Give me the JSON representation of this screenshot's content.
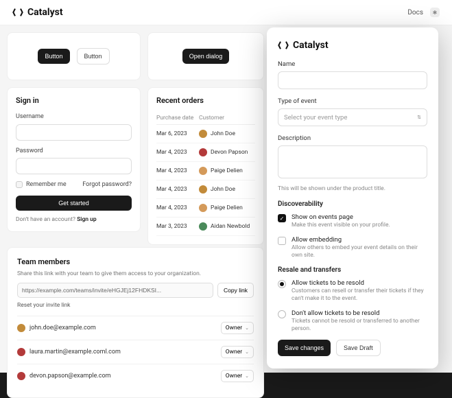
{
  "app": {
    "brand": "Catalyst",
    "docs": "Docs",
    "theme_icon": "✱"
  },
  "buttons_card": {
    "primary": "Button",
    "secondary": "Button"
  },
  "dialog_card": {
    "open": "Open dialog"
  },
  "signin": {
    "title": "Sign in",
    "username_label": "Username",
    "password_label": "Password",
    "remember": "Remember me",
    "forgot": "Forgot password?",
    "submit": "Get started",
    "hint_prefix": "Don't have an account? ",
    "hint_action": "Sign up"
  },
  "orders": {
    "title": "Recent orders",
    "col_date": "Purchase date",
    "col_customer": "Customer",
    "rows": [
      {
        "date": "Mar 6, 2023",
        "customer": "John Doe",
        "color": "#c28b3a"
      },
      {
        "date": "Mar 4, 2023",
        "customer": "Devon Papson",
        "color": "#b33a3a"
      },
      {
        "date": "Mar 4, 2023",
        "customer": "Paige Delien",
        "color": "#d49a5a"
      },
      {
        "date": "Mar 4, 2023",
        "customer": "John Doe",
        "color": "#c28b3a"
      },
      {
        "date": "Mar 4, 2023",
        "customer": "Paige Delien",
        "color": "#d49a5a"
      },
      {
        "date": "Mar 3, 2023",
        "customer": "Aidan Newbold",
        "color": "#4a8a5a"
      }
    ]
  },
  "team": {
    "title": "Team members",
    "subtitle": "Share this link with your team to give them access to your organization.",
    "invite_url": "https://example.com/teams/invite/eHGJEj12FHDKSI...",
    "copy": "Copy link",
    "reset": "Reset your invite link",
    "role_label": "Owner",
    "members": [
      {
        "email": "john.doe@example.com",
        "color": "#c28b3a"
      },
      {
        "email": "laura.martin@example.coml.com",
        "color": "#b33a3a"
      },
      {
        "email": "devon.papson@example.com",
        "color": "#b33a3a"
      }
    ]
  },
  "drawer": {
    "brand": "Catalyst",
    "name_label": "Name",
    "type_label": "Type of event",
    "type_placeholder": "Select your event type",
    "desc_label": "Description",
    "desc_hint": "This will be shown under the product title.",
    "disc_title": "Discoverability",
    "disc_opt1_title": "Show on events page",
    "disc_opt1_desc": "Make this event visible on your profile.",
    "disc_opt2_title": "Allow embedding",
    "disc_opt2_desc": "Allow others to embed your event details on their own site.",
    "resale_title": "Resale and transfers",
    "resale_opt1_title": "Allow tickets to be resold",
    "resale_opt1_desc": "Customers can resell or transfer their tickets if they can't make it to the event.",
    "resale_opt2_title": "Don't allow tickets to be resold",
    "resale_opt2_desc": "Tickets cannot be resold or transferred to another person.",
    "save": "Save changes",
    "draft": "Save Draft"
  }
}
